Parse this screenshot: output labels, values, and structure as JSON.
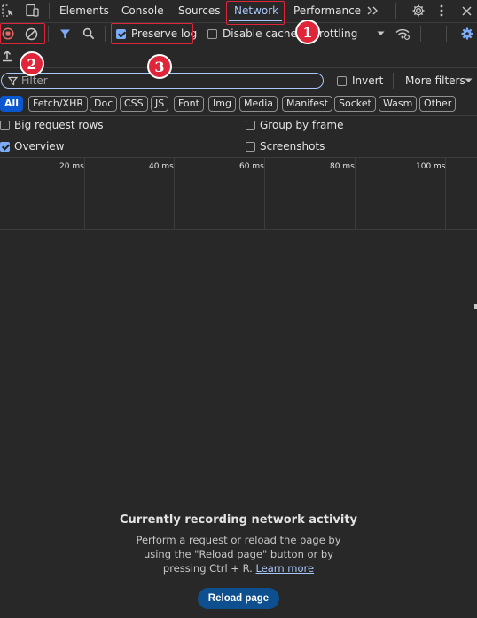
{
  "tabs": [
    {
      "label": "Elements"
    },
    {
      "label": "Console"
    },
    {
      "label": "Sources"
    },
    {
      "label": "Network"
    },
    {
      "label": "Performance"
    }
  ],
  "toolbar": {
    "preserve_log_label": "Preserve log",
    "preserve_log_checked": true,
    "disable_cache_label": "Disable cache",
    "disable_cache_checked": false,
    "throttling_label": "rottling"
  },
  "filter": {
    "placeholder": "Filter",
    "invert_label": "Invert",
    "more_filters_label": "More filters"
  },
  "resource_types": [
    "All",
    "Fetch/XHR",
    "Doc",
    "CSS",
    "JS",
    "Font",
    "Img",
    "Media",
    "Manifest",
    "Socket",
    "Wasm",
    "Other"
  ],
  "options": {
    "big_request_rows": "Big request rows",
    "group_by_frame": "Group by frame",
    "overview": "Overview",
    "screenshots": "Screenshots"
  },
  "timeline": {
    "ticks": [
      "20 ms",
      "40 ms",
      "60 ms",
      "80 ms",
      "100 ms"
    ]
  },
  "empty_state": {
    "title": "Currently recording network activity",
    "body": "Perform a request or reload the page by using the \"Reload page\" button or by pressing Ctrl + R.",
    "learn_more": "Learn more",
    "reload_button": "Reload page"
  },
  "annotations": [
    "1",
    "2",
    "3"
  ],
  "colors": {
    "background": "#282828",
    "accent": "#a8c7fa",
    "record_red": "#e46962",
    "annotation_red": "#e0243a",
    "active_chip": "#0b57d0"
  },
  "icons": [
    "inspect-element-icon",
    "device-toolbar-icon",
    "more-tabs-icon",
    "settings-icon",
    "more-options-icon",
    "close-icon",
    "record-stop-icon",
    "clear-icon",
    "filter-icon",
    "search-icon",
    "network-conditions-icon",
    "network-settings-icon",
    "import-har-icon",
    "filter-funnel-icon",
    "dropdown-caret-icon"
  ]
}
